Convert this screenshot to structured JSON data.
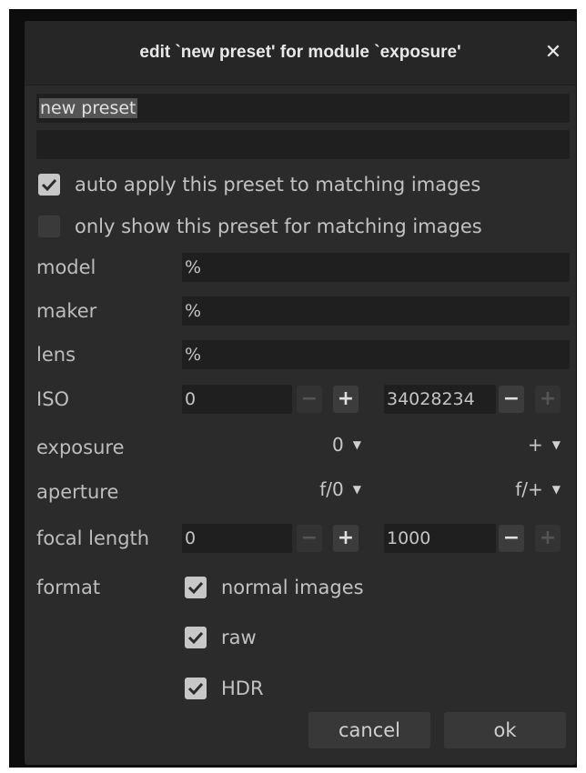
{
  "dialog": {
    "title": "edit `new preset' for module `exposure'",
    "close_glyph": "✕"
  },
  "preset": {
    "name_value": "new preset",
    "description_value": ""
  },
  "options": {
    "auto_apply_label": "auto apply this preset to matching images",
    "auto_apply_checked": true,
    "only_show_label": "only show this preset for matching images",
    "only_show_checked": false
  },
  "filters": {
    "model_label": "model",
    "model_value": "%",
    "maker_label": "maker",
    "maker_value": "%",
    "lens_label": "lens",
    "lens_value": "%",
    "iso_label": "ISO",
    "iso_min": "0",
    "iso_max": "34028234",
    "exposure_label": "exposure",
    "exposure_min": "0",
    "exposure_max": "+",
    "aperture_label": "aperture",
    "aperture_min": "f/0",
    "aperture_max": "f/+",
    "focal_label": "focal length",
    "focal_min": "0",
    "focal_max": "1000",
    "minus_glyph": "−",
    "plus_glyph": "+",
    "dropdown_glyph": "▼"
  },
  "format": {
    "label": "format",
    "normal_label": "normal images",
    "normal_checked": true,
    "raw_label": "raw",
    "raw_checked": true,
    "hdr_label": "HDR",
    "hdr_checked": true
  },
  "buttons": {
    "cancel": "cancel",
    "ok": "ok"
  },
  "colors": {
    "dialog_bg": "#2b2b2b",
    "field_bg": "#1f1f1f",
    "checkbox_checked": "#c7c7c7",
    "button_bg": "#383838"
  },
  "icons": {
    "close": "close-icon",
    "check": "checkmark-icon",
    "dropdown": "chevron-down-icon"
  }
}
